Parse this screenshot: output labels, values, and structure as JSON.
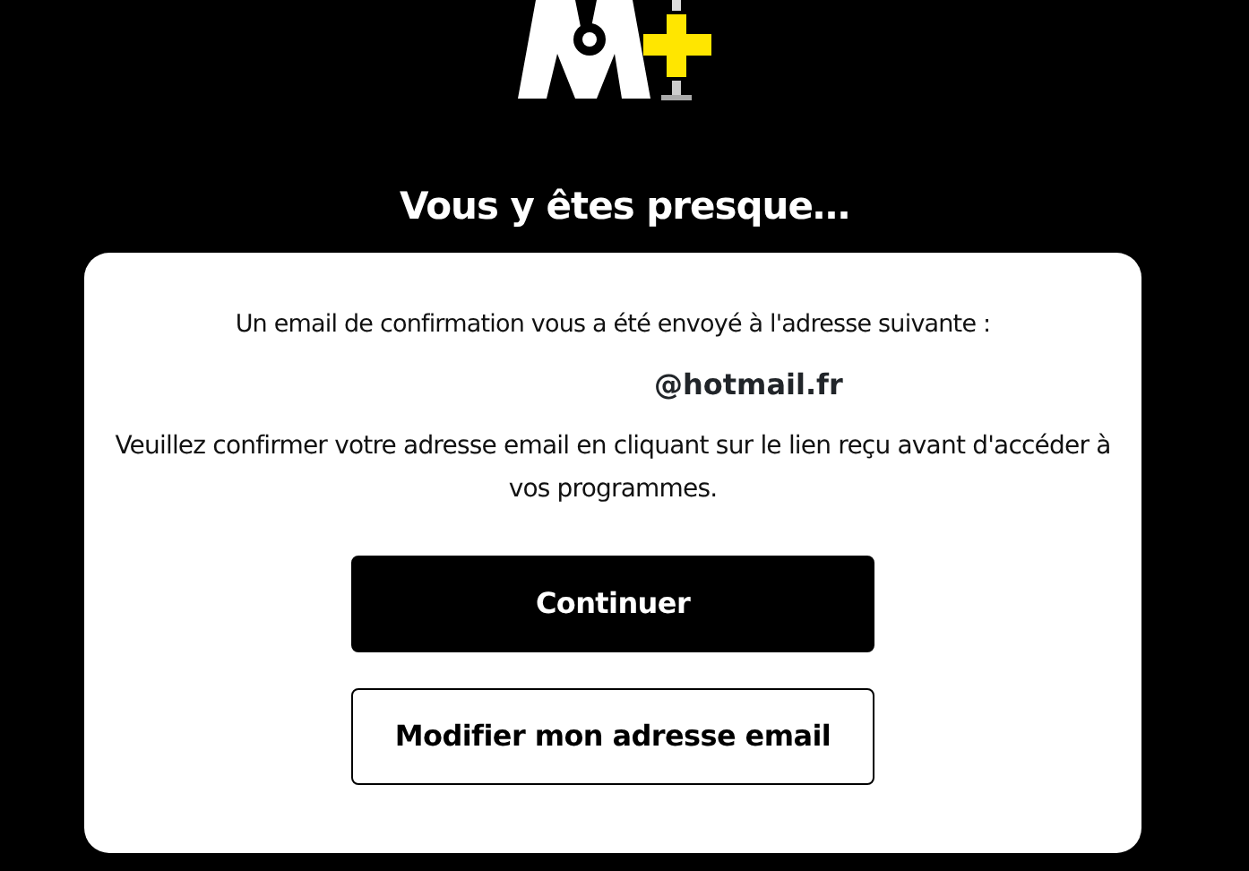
{
  "title": "Vous y êtes presque…",
  "card": {
    "intro": "Un email de confirmation vous a été envoyé à l'adresse suivante :",
    "email": "@hotmail.fr",
    "instructions": "Veuillez confirmer votre adresse email en cliquant sur le lien reçu avant d'accéder à vos programmes."
  },
  "buttons": [
    {
      "label": "Continuer",
      "kind": "primary"
    },
    {
      "label": "Modifier mon adresse email",
      "kind": "outline"
    }
  ]
}
